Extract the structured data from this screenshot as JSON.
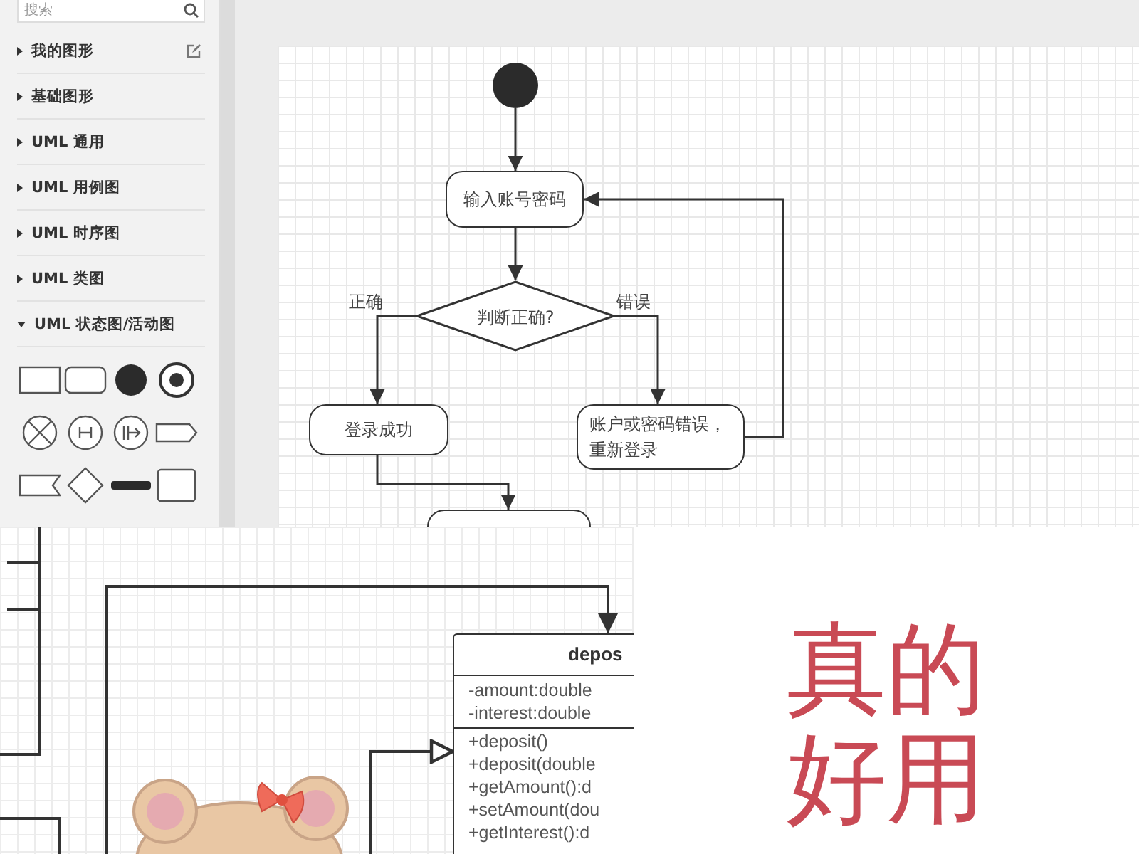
{
  "sidebar": {
    "search": {
      "placeholder": "搜索"
    },
    "items": [
      {
        "label": "我的图形",
        "expanded": false,
        "editable": true
      },
      {
        "label": "基础图形",
        "expanded": false,
        "editable": false
      },
      {
        "label": "UML 通用",
        "expanded": false,
        "editable": false
      },
      {
        "label": "UML 用例图",
        "expanded": false,
        "editable": false
      },
      {
        "label": "UML 时序图",
        "expanded": false,
        "editable": false
      },
      {
        "label": "UML 类图",
        "expanded": false,
        "editable": false
      },
      {
        "label": "UML 状态图/活动图",
        "expanded": true,
        "editable": false
      }
    ]
  },
  "flowchart": {
    "nodes": [
      {
        "kind": "start"
      },
      {
        "kind": "action",
        "text": "输入账号密码"
      },
      {
        "kind": "decision",
        "text": "判断正确?"
      },
      {
        "kind": "action",
        "text": "登录成功"
      },
      {
        "kind": "action",
        "text": "账户或密码错误，重新登录"
      },
      {
        "kind": "action"
      }
    ],
    "edge_labels": [
      {
        "text": "正确"
      },
      {
        "text": "错误"
      }
    ]
  },
  "class_diagram": {
    "name": "depos",
    "attributes": [
      "-amount:double",
      "-interest:double"
    ],
    "methods": [
      "+deposit()",
      "+deposit(double",
      "+getAmount():d",
      "+setAmount(dou",
      "+getInterest():d"
    ]
  },
  "slogan": {
    "text": "真的好用"
  }
}
